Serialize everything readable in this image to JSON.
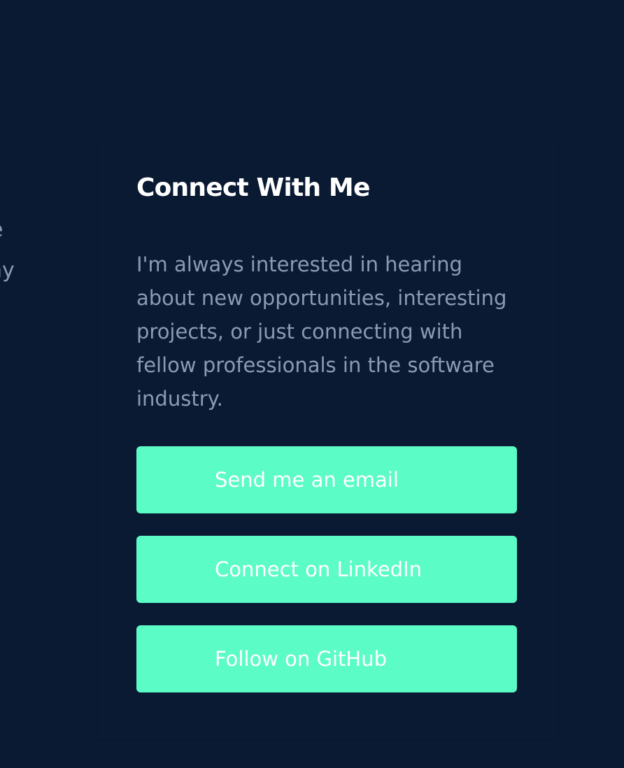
{
  "left_fragment": {
    "line1": "e",
    "line2": "ny"
  },
  "connect": {
    "title": "Connect With Me",
    "description": "I'm always interested in hearing about new opportunities, interesting projects, or just connecting with fellow professionals in the software industry.",
    "buttons": [
      {
        "label": "Send me an email"
      },
      {
        "label": "Connect on LinkedIn"
      },
      {
        "label": "Follow on GitHub"
      }
    ]
  },
  "colors": {
    "background": "#0b1a33",
    "button": "#5cfcc6",
    "title": "#ffffff",
    "body_text": "#8b9bb4"
  }
}
